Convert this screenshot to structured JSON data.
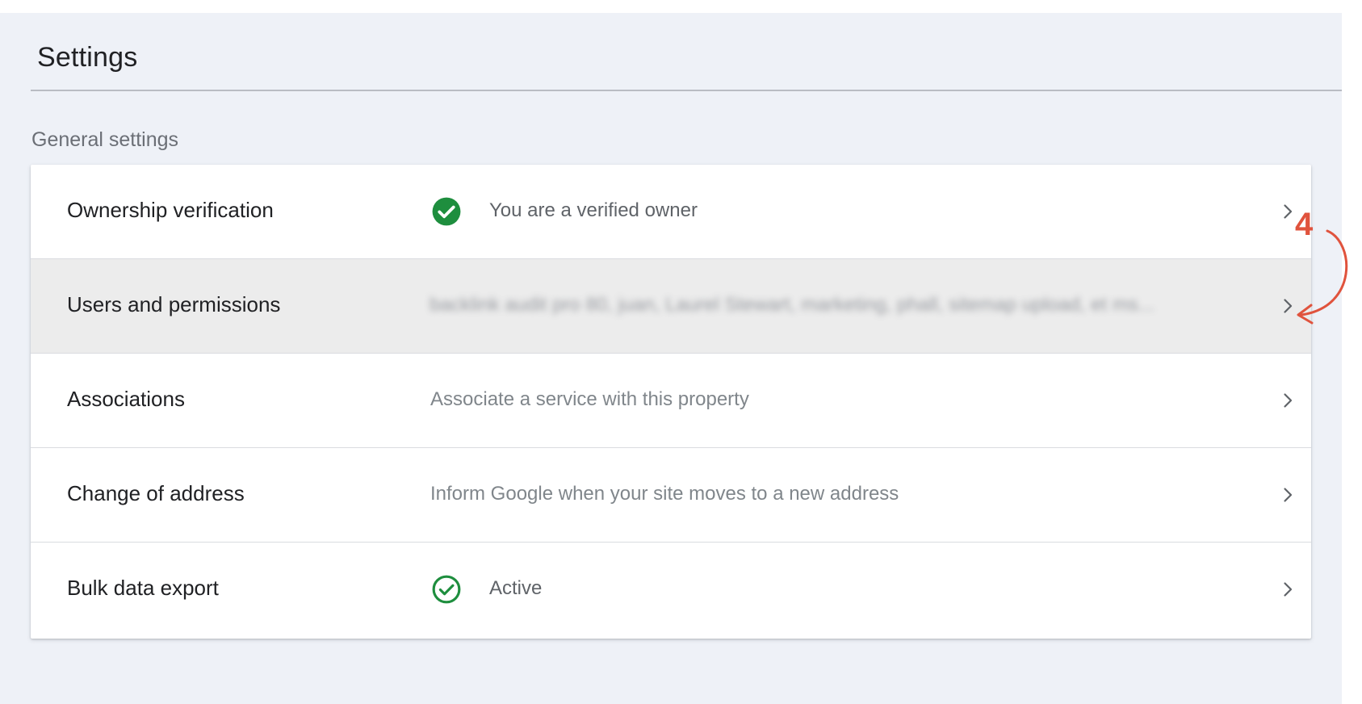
{
  "header": {
    "title": "Settings"
  },
  "section": {
    "label": "General settings"
  },
  "rows": [
    {
      "label": "Ownership verification",
      "value": "You are a verified owner",
      "icon": "check-circle-filled-icon",
      "icon_color": "#1e8e3e"
    },
    {
      "label": "Users and permissions",
      "value": "backlink audit pro 80, juan, Laurel Stewart, marketing, phall, sitemap upload, et ms...",
      "highlighted": true,
      "blurred": true
    },
    {
      "label": "Associations",
      "value": "Associate a service with this property"
    },
    {
      "label": "Change of address",
      "value": "Inform Google when your site moves to a new address"
    },
    {
      "label": "Bulk data export",
      "value": "Active",
      "icon": "check-circle-outline-icon",
      "icon_color": "#1e8e3e"
    }
  ],
  "annotation": {
    "step_number": "4",
    "color": "#e0533d"
  },
  "colors": {
    "background": "#eef1f7",
    "card": "#ffffff",
    "highlight_row": "#ececec",
    "success": "#1e8e3e"
  }
}
